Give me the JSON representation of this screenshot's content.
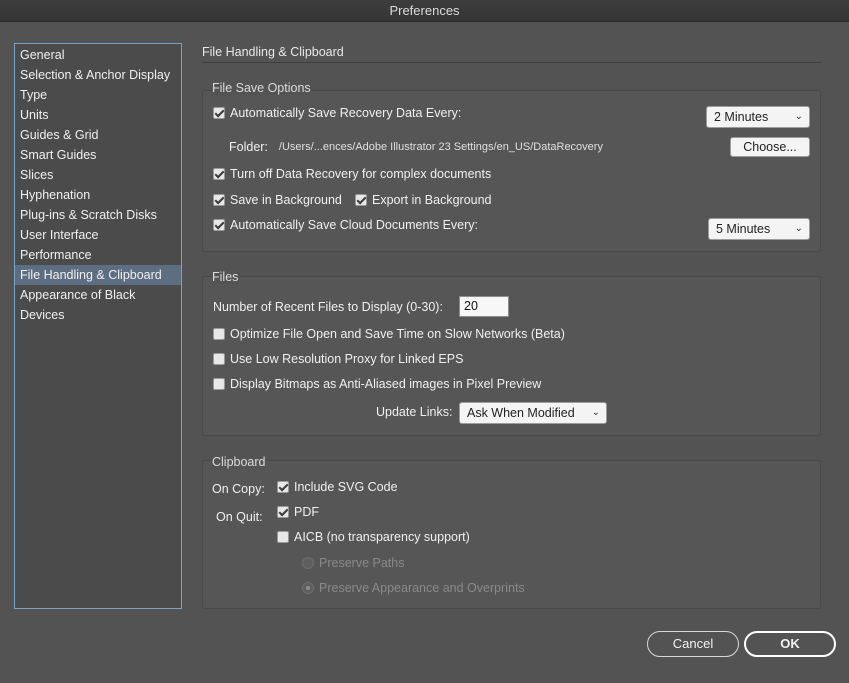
{
  "window": {
    "title": "Preferences"
  },
  "sidebar": {
    "items": [
      {
        "label": "General"
      },
      {
        "label": "Selection & Anchor Display"
      },
      {
        "label": "Type"
      },
      {
        "label": "Units"
      },
      {
        "label": "Guides & Grid"
      },
      {
        "label": "Smart Guides"
      },
      {
        "label": "Slices"
      },
      {
        "label": "Hyphenation"
      },
      {
        "label": "Plug-ins & Scratch Disks"
      },
      {
        "label": "User Interface"
      },
      {
        "label": "Performance"
      },
      {
        "label": "File Handling & Clipboard"
      },
      {
        "label": "Appearance of Black"
      },
      {
        "label": "Devices"
      }
    ],
    "selected_index": 11
  },
  "main": {
    "title": "File Handling & Clipboard",
    "file_save": {
      "label": "File Save Options",
      "auto_save_label": "Automatically Save Recovery Data Every:",
      "auto_save_checked": true,
      "auto_save_interval": "2 Minutes",
      "folder_label": "Folder:",
      "folder_path": "/Users/...ences/Adobe Illustrator 23 Settings/en_US/DataRecovery",
      "choose_label": "Choose...",
      "turn_off_label": "Turn off Data Recovery for complex documents",
      "turn_off_checked": true,
      "save_bg_label": "Save in Background",
      "save_bg_checked": true,
      "export_bg_label": "Export in Background",
      "export_bg_checked": true,
      "cloud_label": "Automatically Save Cloud Documents Every:",
      "cloud_checked": true,
      "cloud_interval": "5 Minutes"
    },
    "files": {
      "label": "Files",
      "recent_label": "Number of Recent Files to Display (0-30):",
      "recent_value": "20",
      "optimize_label": "Optimize File Open and Save Time on Slow Networks (Beta)",
      "low_res_label": "Use Low Resolution Proxy for Linked EPS",
      "bitmaps_label": "Display Bitmaps as Anti-Aliased images in Pixel Preview",
      "update_links_label": "Update Links:",
      "update_links_value": "Ask When Modified"
    },
    "clipboard": {
      "label": "Clipboard",
      "on_copy_label": "On Copy:",
      "svg_label": "Include SVG Code",
      "svg_checked": true,
      "on_quit_label": "On Quit:",
      "pdf_label": "PDF",
      "pdf_checked": true,
      "aicb_label": "AICB (no transparency support)",
      "aicb_checked": false,
      "preserve_paths_label": "Preserve Paths",
      "preserve_appearance_label": "Preserve Appearance and Overprints"
    }
  },
  "footer": {
    "cancel_label": "Cancel",
    "ok_label": "OK"
  }
}
